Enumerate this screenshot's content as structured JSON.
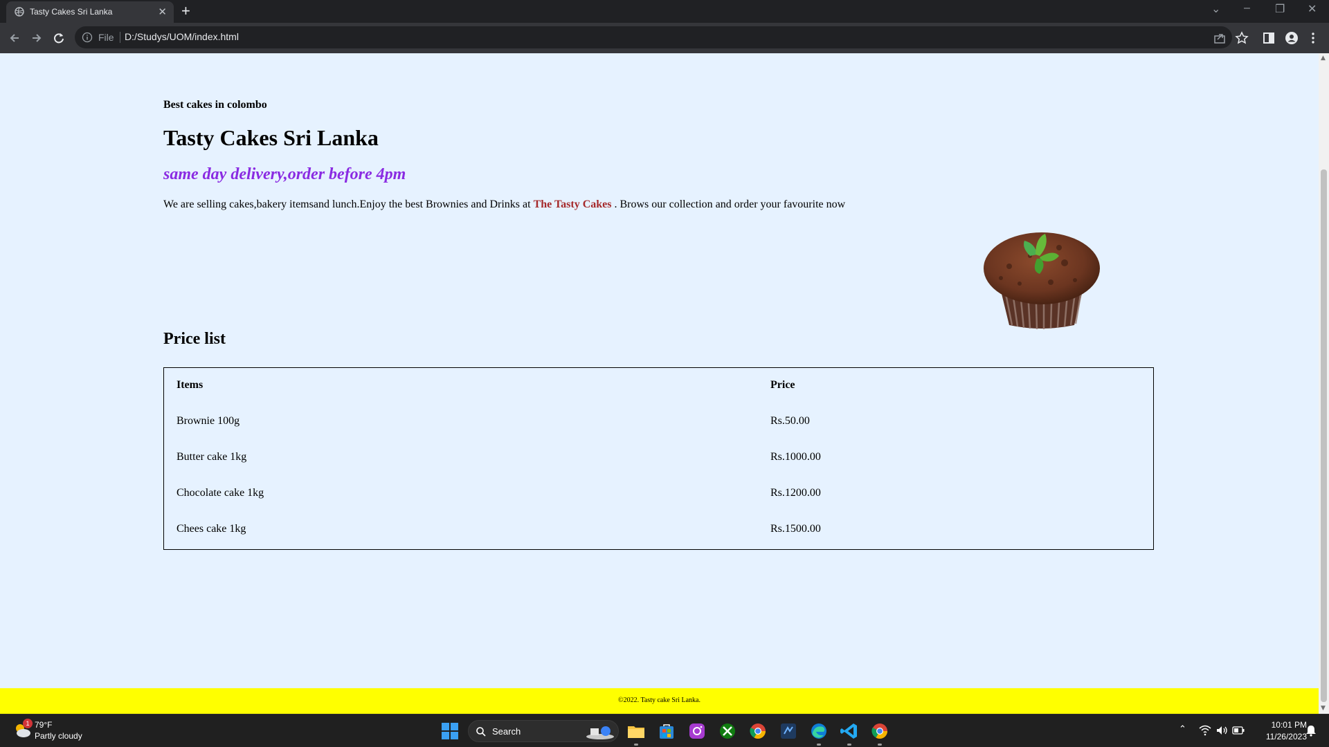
{
  "browser": {
    "tab_title": "Tasty Cakes Sri Lanka",
    "tab_close": "✕",
    "new_tab": "+",
    "scheme_label": "File",
    "url": "D:/Studys/UOM/index.html",
    "window_controls": {
      "tabs_menu": "⌄",
      "minimize": "–",
      "restore": "❐",
      "close": "✕"
    }
  },
  "page": {
    "small_title": "Best cakes in colombo",
    "main_title": "Tasty Cakes Sri Lanka",
    "tagline": "same day delivery,order before 4pm",
    "intro_before": "We are selling cakes,bakery itemsand lunch.Enjoy the best Brownies and Drinks at ",
    "intro_brand": "The Tasty Cakes",
    "intro_after": " . Brows our collection and order your favourite now",
    "price_heading": "Price list",
    "table": {
      "headers": [
        "Items",
        "Price"
      ],
      "rows": [
        [
          "Brownie 100g",
          "Rs.50.00"
        ],
        [
          "Butter cake 1kg",
          "Rs.1000.00"
        ],
        [
          "Chocolate cake 1kg",
          "Rs.1200.00"
        ],
        [
          "Chees cake 1kg",
          "Rs.1500.00"
        ]
      ]
    },
    "footer": "©2022. Tasty cake Sri Lanka."
  },
  "colors": {
    "page_bg": "#e6f2ff",
    "tagline": "#8a2be2",
    "brand": "#a52a2a",
    "footer_bg": "#ffff00"
  },
  "taskbar": {
    "weather_temp": "79°F",
    "weather_desc": "Partly cloudy",
    "weather_badge": "1",
    "search_label": "Search",
    "apps": [
      "file-explorer-icon",
      "microsoft-store-icon",
      "instagram-icon",
      "xbox-icon",
      "chrome-icon",
      "ide-icon",
      "edge-icon",
      "vscode-icon",
      "chrome-icon"
    ],
    "time": "10:01 PM",
    "date": "11/26/2023"
  }
}
